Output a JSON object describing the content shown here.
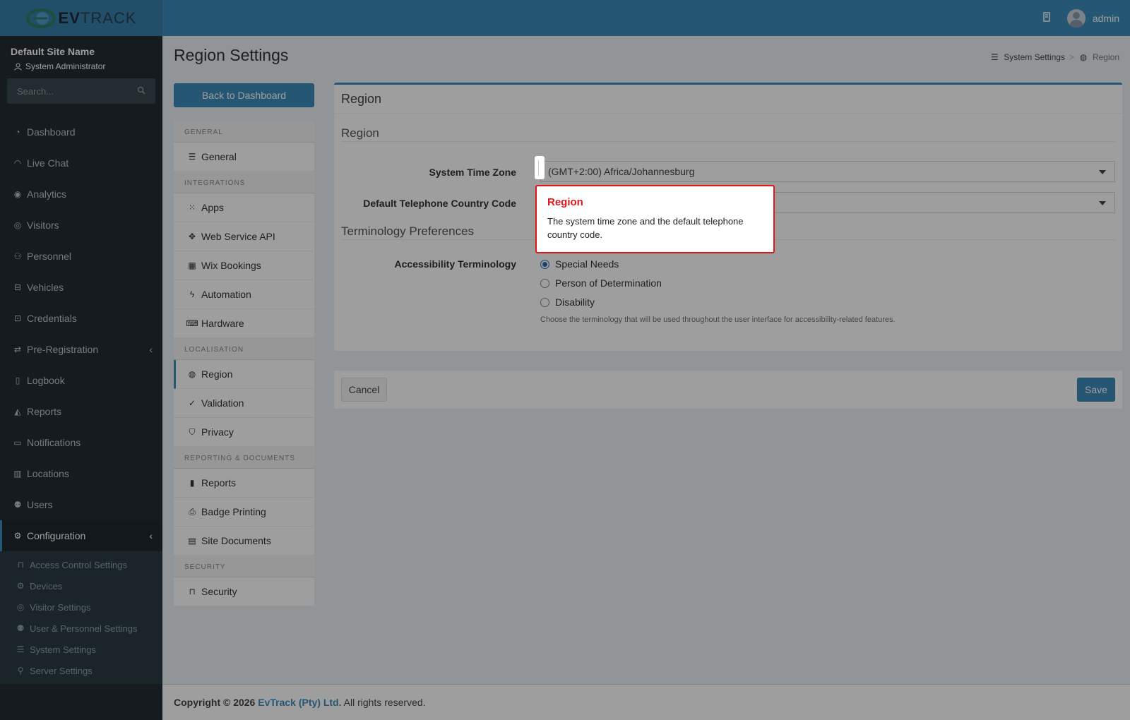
{
  "header": {
    "logo_text_bold": "EV",
    "logo_text_rest": "TRACK",
    "user_name": "admin"
  },
  "sidebar": {
    "site_name": "Default Site Name",
    "site_role": "System Administrator",
    "search_placeholder": "Search...",
    "items": [
      {
        "label": "Dashboard",
        "icon": "dashboard-icon"
      },
      {
        "label": "Live Chat",
        "icon": "headset-icon"
      },
      {
        "label": "Analytics",
        "icon": "analytics-icon"
      },
      {
        "label": "Visitors",
        "icon": "eye-icon"
      },
      {
        "label": "Personnel",
        "icon": "personnel-icon"
      },
      {
        "label": "Vehicles",
        "icon": "car-icon"
      },
      {
        "label": "Credentials",
        "icon": "credentials-icon"
      },
      {
        "label": "Pre-Registration",
        "icon": "arrows-icon"
      },
      {
        "label": "Logbook",
        "icon": "book-icon"
      },
      {
        "label": "Reports",
        "icon": "chart-icon"
      },
      {
        "label": "Notifications",
        "icon": "chat-icon"
      },
      {
        "label": "Locations",
        "icon": "building-icon"
      },
      {
        "label": "Users",
        "icon": "users-icon"
      },
      {
        "label": "Configuration",
        "icon": "gear-icon"
      }
    ],
    "sub_items": [
      {
        "label": "Access Control Settings",
        "icon": "lock-icon"
      },
      {
        "label": "Devices",
        "icon": "gear-icon"
      },
      {
        "label": "Visitor Settings",
        "icon": "eye-icon"
      },
      {
        "label": "User & Personnel Settings",
        "icon": "users-icon"
      },
      {
        "label": "System Settings",
        "icon": "sliders-icon"
      },
      {
        "label": "Server Settings",
        "icon": "server-icon"
      }
    ]
  },
  "page": {
    "title": "Region Settings",
    "breadcrumb": {
      "parent": "System Settings",
      "current": "Region",
      "sep": ">"
    },
    "back_button": "Back to Dashboard"
  },
  "settings_nav": {
    "groups": [
      {
        "heading": "GENERAL",
        "items": [
          {
            "label": "General",
            "icon": "list-icon"
          }
        ]
      },
      {
        "heading": "INTEGRATIONS",
        "items": [
          {
            "label": "Apps",
            "icon": "grid-icon"
          },
          {
            "label": "Web Service API",
            "icon": "api-icon"
          },
          {
            "label": "Wix Bookings",
            "icon": "calendar-icon"
          },
          {
            "label": "Automation",
            "icon": "bolt-icon"
          },
          {
            "label": "Hardware",
            "icon": "hardware-icon"
          }
        ]
      },
      {
        "heading": "LOCALISATION",
        "items": [
          {
            "label": "Region",
            "icon": "globe-icon"
          },
          {
            "label": "Validation",
            "icon": "check-circle-icon"
          },
          {
            "label": "Privacy",
            "icon": "shield-icon"
          }
        ]
      },
      {
        "heading": "REPORTING & DOCUMENTS",
        "items": [
          {
            "label": "Reports",
            "icon": "bar-chart-icon"
          },
          {
            "label": "Badge Printing",
            "icon": "printer-icon"
          },
          {
            "label": "Site Documents",
            "icon": "document-icon"
          }
        ]
      },
      {
        "heading": "SECURITY",
        "items": [
          {
            "label": "Security",
            "icon": "lock-icon"
          }
        ]
      }
    ]
  },
  "region_box": {
    "title": "Region",
    "section_region": "Region",
    "time_zone_label": "System Time Zone",
    "time_zone_value": "(GMT+2:00) Africa/Johannesburg",
    "phone_code_label": "Default Telephone Country Code",
    "phone_code_value": "",
    "section_terminology": "Terminology Preferences",
    "accessibility_label": "Accessibility Terminology",
    "options": [
      {
        "label": "Special Needs",
        "selected": true
      },
      {
        "label": "Person of Determination",
        "selected": false
      },
      {
        "label": "Disability",
        "selected": false
      }
    ],
    "help_text": "Choose the terminology that will be used throughout the user interface for accessibility-related features."
  },
  "actions": {
    "cancel": "Cancel",
    "save": "Save"
  },
  "footer": {
    "prefix": "Copyright © 2026",
    "company": "EvTrack (Pty) Ltd.",
    "suffix": "All rights reserved."
  },
  "tour": {
    "title": "Region",
    "text": "The system time zone and the default telephone country code."
  },
  "colors": {
    "header": "#3c8dbc",
    "sidebar": "#222d32",
    "accent": "#3c8dbc",
    "tour_border": "#e0161b"
  }
}
